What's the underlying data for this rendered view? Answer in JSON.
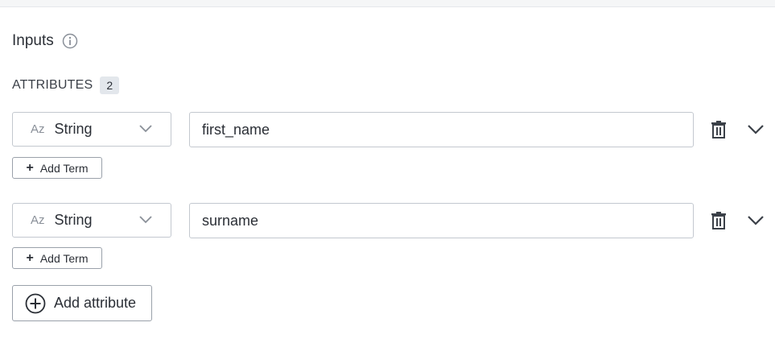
{
  "section": {
    "title": "Inputs",
    "info_icon": "info-icon"
  },
  "attributes": {
    "label": "ATTRIBUTES",
    "count": "2",
    "items": [
      {
        "type_icon": "Az",
        "type": "String",
        "name": "first_name",
        "add_term_label": "Add Term"
      },
      {
        "type_icon": "Az",
        "type": "String",
        "name": "surname",
        "add_term_label": "Add Term"
      }
    ],
    "add_attribute_label": "Add attribute"
  },
  "colors": {
    "border": "#c3c8cf",
    "button_border": "#9aa1aa",
    "text": "#2b2f36",
    "muted_icon": "#8a9099",
    "badge_bg": "#e3e7ec"
  }
}
